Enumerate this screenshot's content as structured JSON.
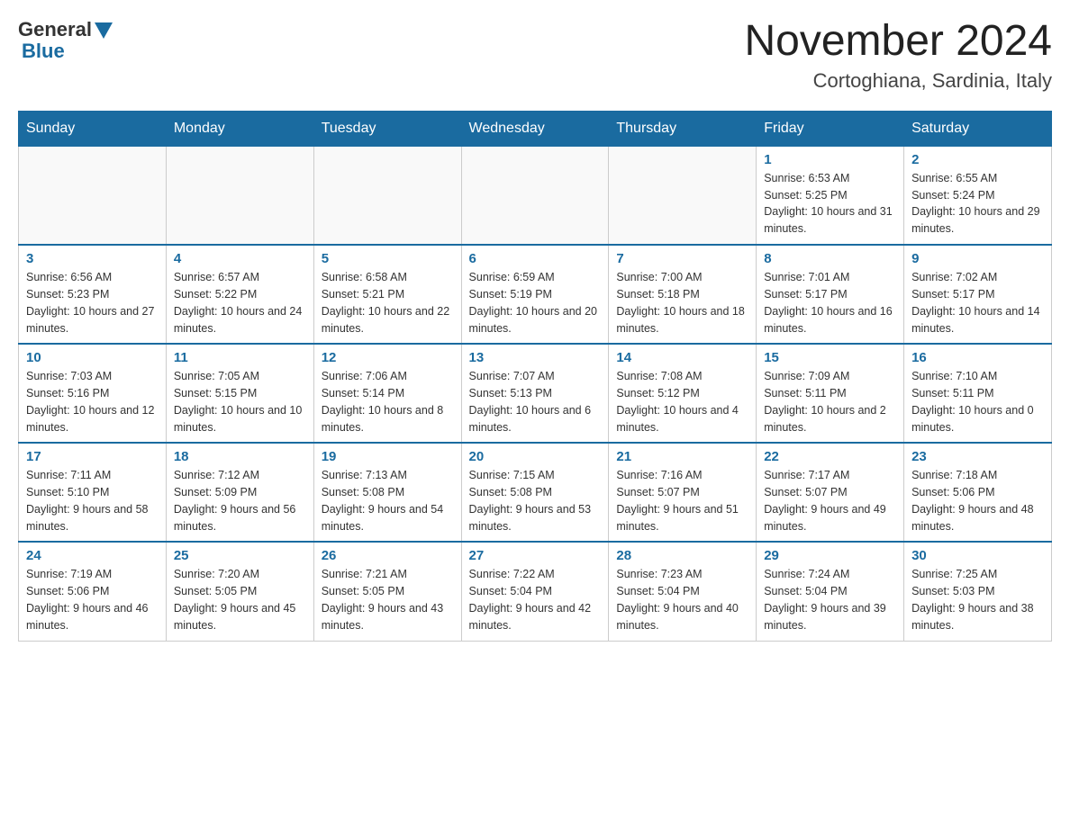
{
  "header": {
    "logo_general": "General",
    "logo_blue": "Blue",
    "month_title": "November 2024",
    "location": "Cortoghiana, Sardinia, Italy"
  },
  "days_of_week": [
    "Sunday",
    "Monday",
    "Tuesday",
    "Wednesday",
    "Thursday",
    "Friday",
    "Saturday"
  ],
  "weeks": [
    [
      {
        "day": "",
        "sunrise": "",
        "sunset": "",
        "daylight": ""
      },
      {
        "day": "",
        "sunrise": "",
        "sunset": "",
        "daylight": ""
      },
      {
        "day": "",
        "sunrise": "",
        "sunset": "",
        "daylight": ""
      },
      {
        "day": "",
        "sunrise": "",
        "sunset": "",
        "daylight": ""
      },
      {
        "day": "",
        "sunrise": "",
        "sunset": "",
        "daylight": ""
      },
      {
        "day": "1",
        "sunrise": "Sunrise: 6:53 AM",
        "sunset": "Sunset: 5:25 PM",
        "daylight": "Daylight: 10 hours and 31 minutes."
      },
      {
        "day": "2",
        "sunrise": "Sunrise: 6:55 AM",
        "sunset": "Sunset: 5:24 PM",
        "daylight": "Daylight: 10 hours and 29 minutes."
      }
    ],
    [
      {
        "day": "3",
        "sunrise": "Sunrise: 6:56 AM",
        "sunset": "Sunset: 5:23 PM",
        "daylight": "Daylight: 10 hours and 27 minutes."
      },
      {
        "day": "4",
        "sunrise": "Sunrise: 6:57 AM",
        "sunset": "Sunset: 5:22 PM",
        "daylight": "Daylight: 10 hours and 24 minutes."
      },
      {
        "day": "5",
        "sunrise": "Sunrise: 6:58 AM",
        "sunset": "Sunset: 5:21 PM",
        "daylight": "Daylight: 10 hours and 22 minutes."
      },
      {
        "day": "6",
        "sunrise": "Sunrise: 6:59 AM",
        "sunset": "Sunset: 5:19 PM",
        "daylight": "Daylight: 10 hours and 20 minutes."
      },
      {
        "day": "7",
        "sunrise": "Sunrise: 7:00 AM",
        "sunset": "Sunset: 5:18 PM",
        "daylight": "Daylight: 10 hours and 18 minutes."
      },
      {
        "day": "8",
        "sunrise": "Sunrise: 7:01 AM",
        "sunset": "Sunset: 5:17 PM",
        "daylight": "Daylight: 10 hours and 16 minutes."
      },
      {
        "day": "9",
        "sunrise": "Sunrise: 7:02 AM",
        "sunset": "Sunset: 5:17 PM",
        "daylight": "Daylight: 10 hours and 14 minutes."
      }
    ],
    [
      {
        "day": "10",
        "sunrise": "Sunrise: 7:03 AM",
        "sunset": "Sunset: 5:16 PM",
        "daylight": "Daylight: 10 hours and 12 minutes."
      },
      {
        "day": "11",
        "sunrise": "Sunrise: 7:05 AM",
        "sunset": "Sunset: 5:15 PM",
        "daylight": "Daylight: 10 hours and 10 minutes."
      },
      {
        "day": "12",
        "sunrise": "Sunrise: 7:06 AM",
        "sunset": "Sunset: 5:14 PM",
        "daylight": "Daylight: 10 hours and 8 minutes."
      },
      {
        "day": "13",
        "sunrise": "Sunrise: 7:07 AM",
        "sunset": "Sunset: 5:13 PM",
        "daylight": "Daylight: 10 hours and 6 minutes."
      },
      {
        "day": "14",
        "sunrise": "Sunrise: 7:08 AM",
        "sunset": "Sunset: 5:12 PM",
        "daylight": "Daylight: 10 hours and 4 minutes."
      },
      {
        "day": "15",
        "sunrise": "Sunrise: 7:09 AM",
        "sunset": "Sunset: 5:11 PM",
        "daylight": "Daylight: 10 hours and 2 minutes."
      },
      {
        "day": "16",
        "sunrise": "Sunrise: 7:10 AM",
        "sunset": "Sunset: 5:11 PM",
        "daylight": "Daylight: 10 hours and 0 minutes."
      }
    ],
    [
      {
        "day": "17",
        "sunrise": "Sunrise: 7:11 AM",
        "sunset": "Sunset: 5:10 PM",
        "daylight": "Daylight: 9 hours and 58 minutes."
      },
      {
        "day": "18",
        "sunrise": "Sunrise: 7:12 AM",
        "sunset": "Sunset: 5:09 PM",
        "daylight": "Daylight: 9 hours and 56 minutes."
      },
      {
        "day": "19",
        "sunrise": "Sunrise: 7:13 AM",
        "sunset": "Sunset: 5:08 PM",
        "daylight": "Daylight: 9 hours and 54 minutes."
      },
      {
        "day": "20",
        "sunrise": "Sunrise: 7:15 AM",
        "sunset": "Sunset: 5:08 PM",
        "daylight": "Daylight: 9 hours and 53 minutes."
      },
      {
        "day": "21",
        "sunrise": "Sunrise: 7:16 AM",
        "sunset": "Sunset: 5:07 PM",
        "daylight": "Daylight: 9 hours and 51 minutes."
      },
      {
        "day": "22",
        "sunrise": "Sunrise: 7:17 AM",
        "sunset": "Sunset: 5:07 PM",
        "daylight": "Daylight: 9 hours and 49 minutes."
      },
      {
        "day": "23",
        "sunrise": "Sunrise: 7:18 AM",
        "sunset": "Sunset: 5:06 PM",
        "daylight": "Daylight: 9 hours and 48 minutes."
      }
    ],
    [
      {
        "day": "24",
        "sunrise": "Sunrise: 7:19 AM",
        "sunset": "Sunset: 5:06 PM",
        "daylight": "Daylight: 9 hours and 46 minutes."
      },
      {
        "day": "25",
        "sunrise": "Sunrise: 7:20 AM",
        "sunset": "Sunset: 5:05 PM",
        "daylight": "Daylight: 9 hours and 45 minutes."
      },
      {
        "day": "26",
        "sunrise": "Sunrise: 7:21 AM",
        "sunset": "Sunset: 5:05 PM",
        "daylight": "Daylight: 9 hours and 43 minutes."
      },
      {
        "day": "27",
        "sunrise": "Sunrise: 7:22 AM",
        "sunset": "Sunset: 5:04 PM",
        "daylight": "Daylight: 9 hours and 42 minutes."
      },
      {
        "day": "28",
        "sunrise": "Sunrise: 7:23 AM",
        "sunset": "Sunset: 5:04 PM",
        "daylight": "Daylight: 9 hours and 40 minutes."
      },
      {
        "day": "29",
        "sunrise": "Sunrise: 7:24 AM",
        "sunset": "Sunset: 5:04 PM",
        "daylight": "Daylight: 9 hours and 39 minutes."
      },
      {
        "day": "30",
        "sunrise": "Sunrise: 7:25 AM",
        "sunset": "Sunset: 5:03 PM",
        "daylight": "Daylight: 9 hours and 38 minutes."
      }
    ]
  ]
}
